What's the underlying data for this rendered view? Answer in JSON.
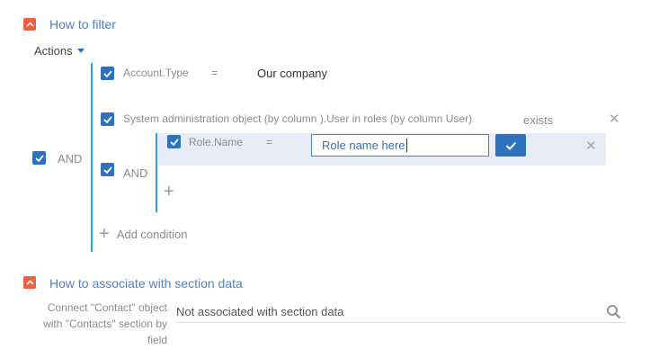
{
  "filter_section": {
    "title": "How to filter",
    "actions_label": "Actions",
    "root_group": {
      "operator": "AND",
      "conditions": [
        {
          "column": "Account.Type",
          "comparison": "=",
          "value": "Our company"
        },
        {
          "column": "System administration object (by column ).User in roles (by column User)",
          "comparison": "exists"
        }
      ],
      "nested_group": {
        "operator": "AND",
        "condition": {
          "column": "Role.Name",
          "comparison": "=",
          "input_value": "Role name here"
        }
      },
      "add_condition_label": "Add condition"
    }
  },
  "association_section": {
    "title": "How to associate with section data",
    "field_label": "Connect \"Contact\" object with \"Contacts\" section by field",
    "field_value": "Not associated with section data"
  },
  "colors": {
    "accent_orange": "#f15e3f",
    "checkbox_blue": "#2e71bf",
    "link_blue": "#4c83c6",
    "group_line": "#27a5dd",
    "editing_row_bg": "#e7ecf8"
  },
  "icons": [
    "collapse-icon",
    "caret-down-icon",
    "check-icon",
    "close-icon",
    "plus-icon",
    "search-icon"
  ]
}
